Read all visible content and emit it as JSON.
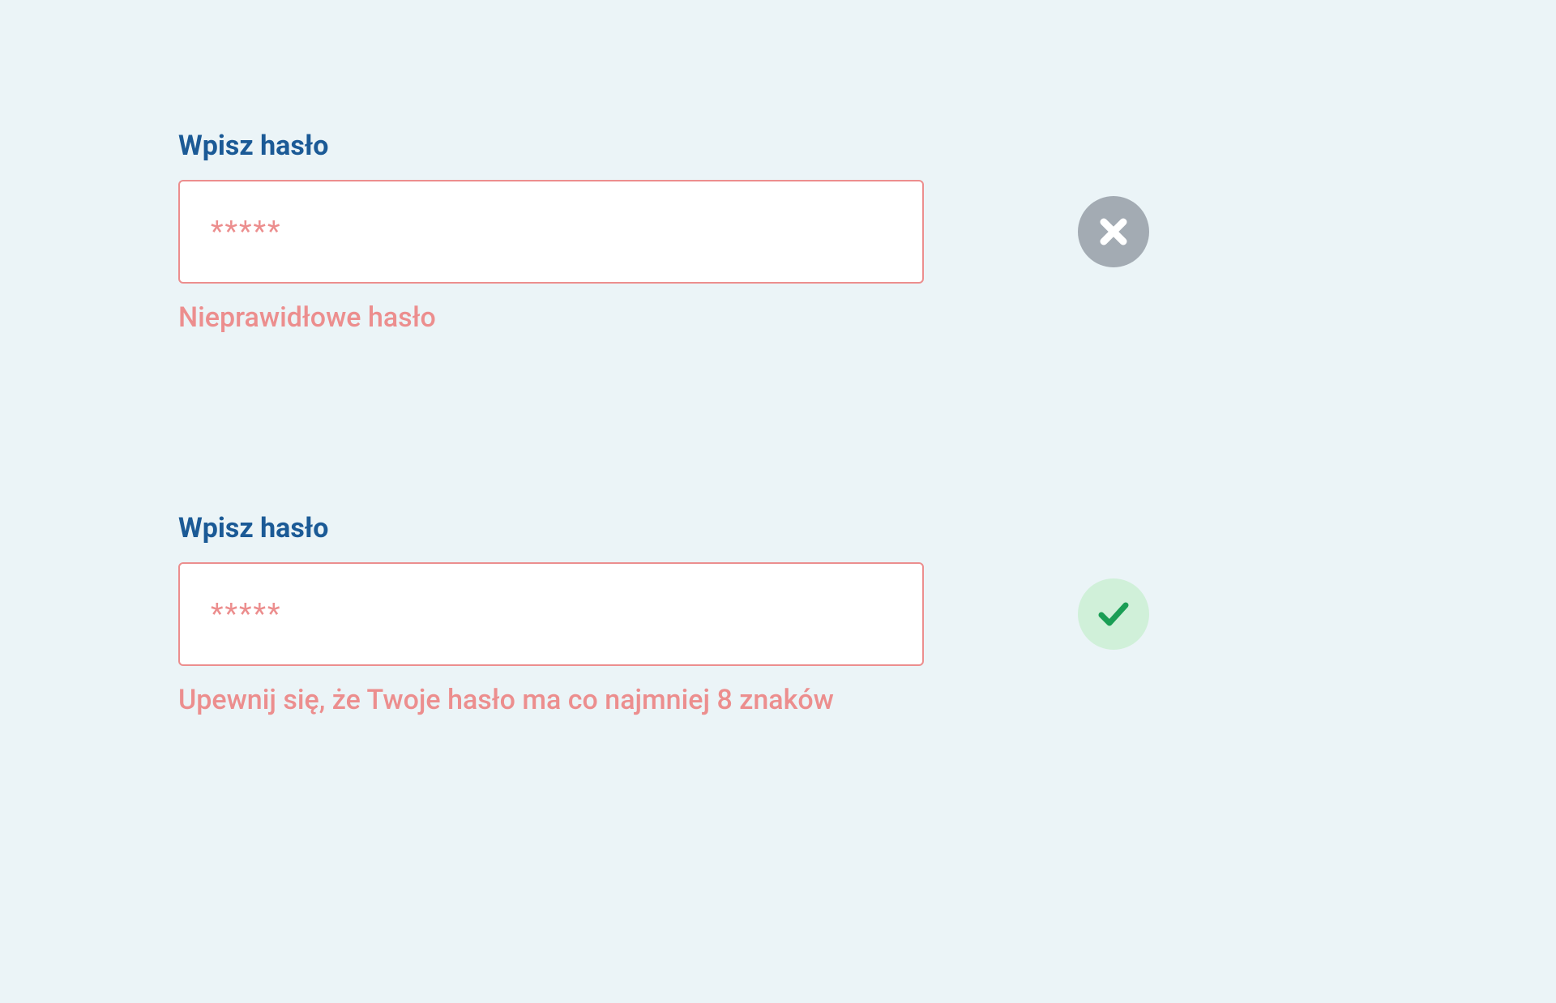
{
  "examples": [
    {
      "label": "Wpisz hasło",
      "value": "*****",
      "hint": "Nieprawidłowe hasło",
      "status": "bad"
    },
    {
      "label": "Wpisz hasło",
      "value": "*****",
      "hint": "Upewnij się, że Twoje hasło ma co najmniej 8 znaków",
      "status": "good"
    }
  ]
}
